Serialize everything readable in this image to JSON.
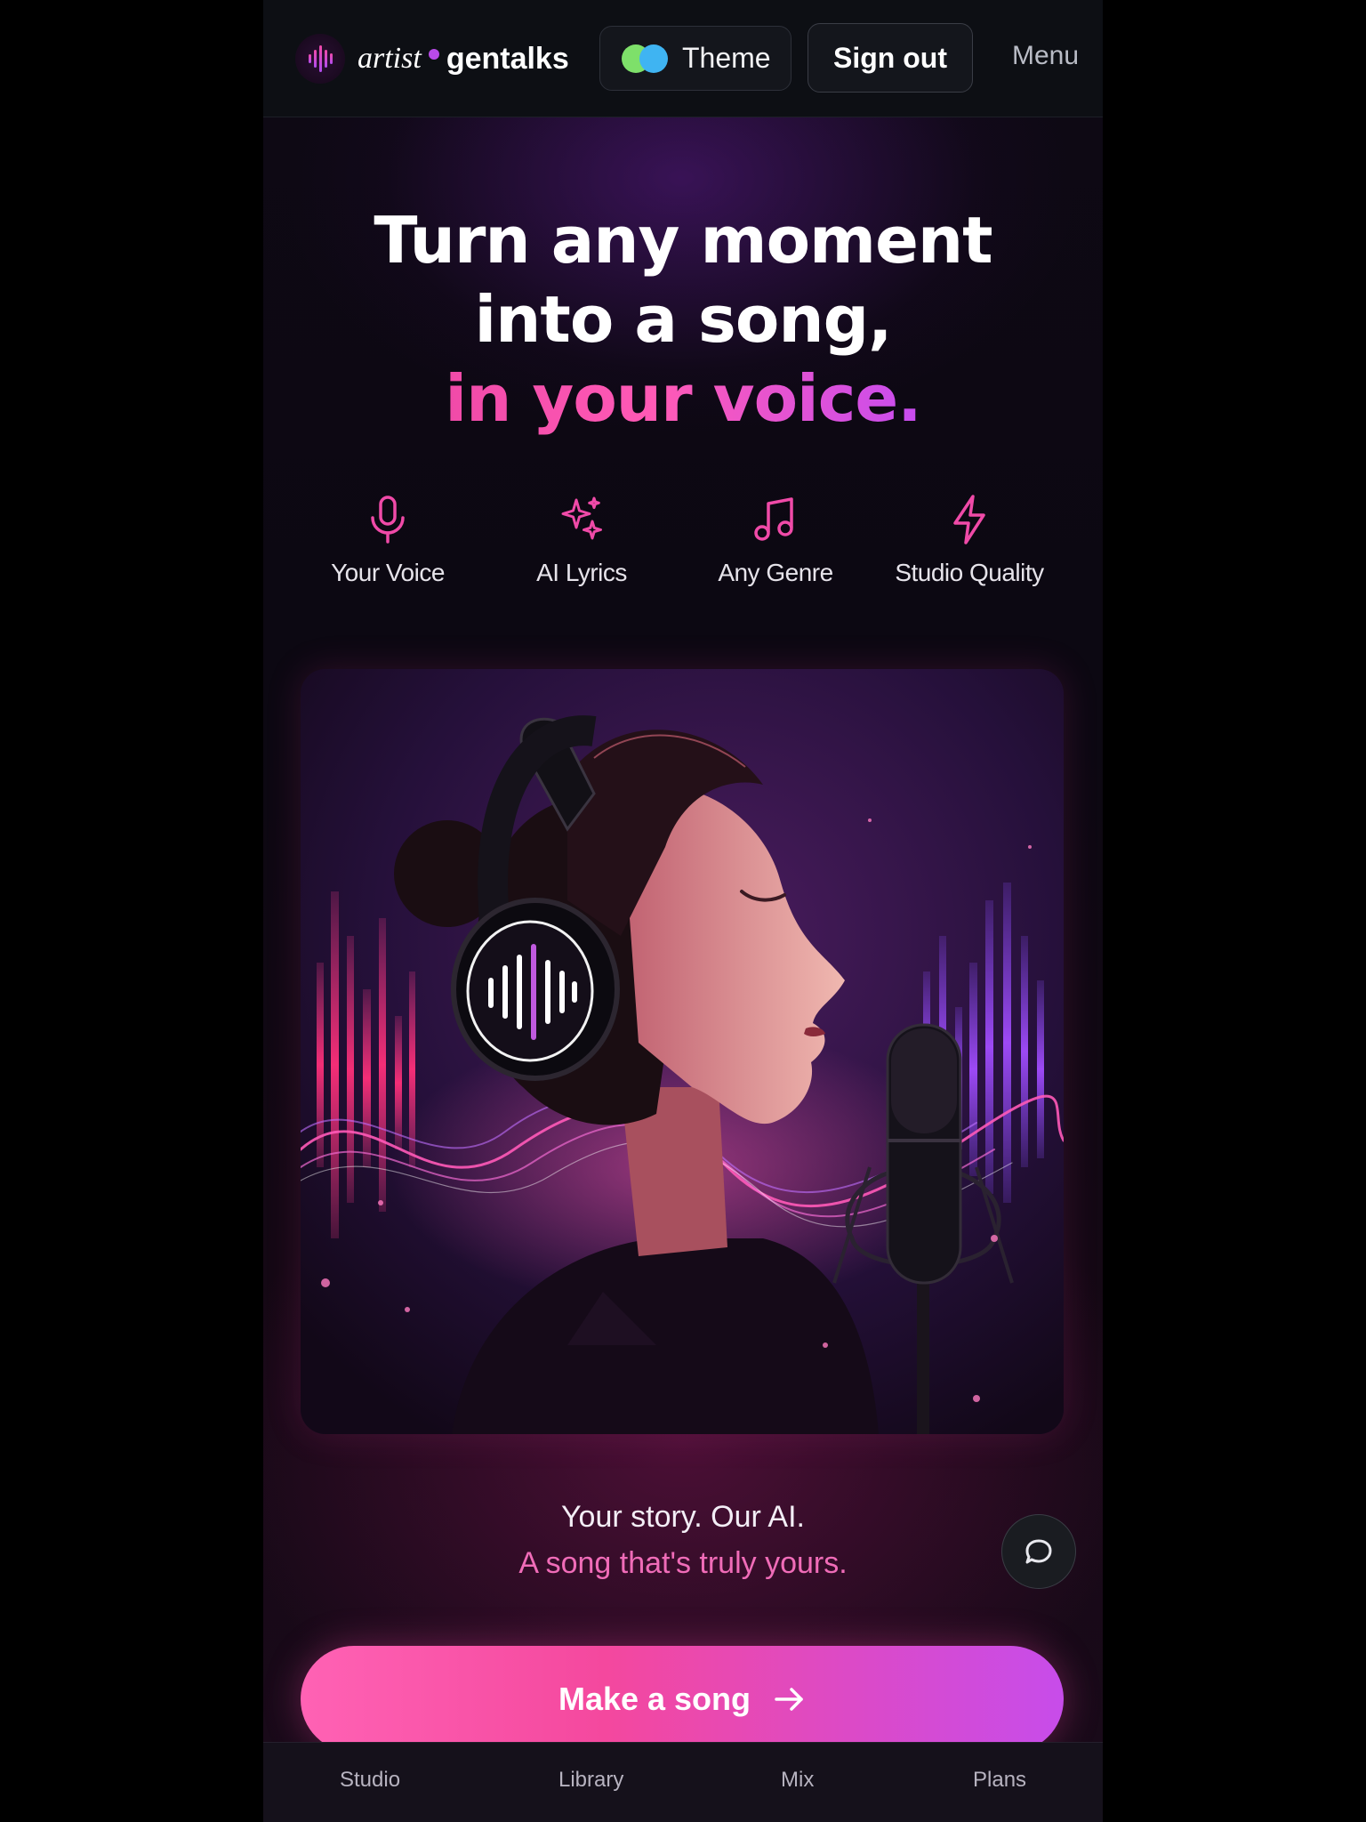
{
  "header": {
    "brand_part1": "artist",
    "brand_part2": "gentalks",
    "theme_label": "Theme",
    "sign_out_label": "Sign out",
    "menu_label": "Menu"
  },
  "hero": {
    "headline_line1": "Turn any moment",
    "headline_line2": "into a song,",
    "headline_accent": "in your voice."
  },
  "features": [
    {
      "icon": "microphone-icon",
      "label": "Your Voice"
    },
    {
      "icon": "sparkles-icon",
      "label": "AI Lyrics"
    },
    {
      "icon": "music-note-icon",
      "label": "Any Genre"
    },
    {
      "icon": "lightning-icon",
      "label": "Studio Quality"
    }
  ],
  "tagline": {
    "line1": "Your story. Our AI.",
    "line2": "A song that's truly yours."
  },
  "cta": {
    "label": "Make a song"
  },
  "bottom_nav": [
    {
      "label": "Studio"
    },
    {
      "label": "Library"
    },
    {
      "label": "Mix"
    },
    {
      "label": "Plans"
    }
  ],
  "colors": {
    "accent_pink": "#f04aa8",
    "accent_purple": "#c74cf0",
    "background": "#0b0710"
  }
}
